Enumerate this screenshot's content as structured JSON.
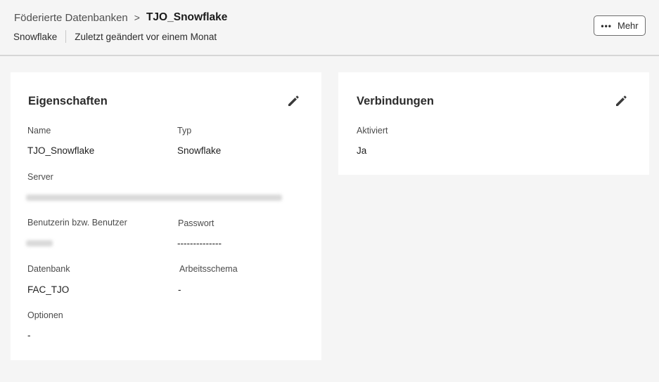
{
  "header": {
    "breadcrumb_parent": "Föderierte Datenbanken",
    "breadcrumb_separator": ">",
    "breadcrumb_current": "TJO_Snowflake",
    "db_type": "Snowflake",
    "last_modified": "Zuletzt geändert vor einem Monat",
    "more_button_label": "Mehr",
    "more_button_icon": "more-dots-icon"
  },
  "properties": {
    "title": "Eigenschaften",
    "edit_icon": "pencil-icon",
    "name_label": "Name",
    "name_value": "TJO_Snowflake",
    "type_label": "Typ",
    "type_value": "Snowflake",
    "server_label": "Server",
    "user_label": "Benutzerin bzw. Benutzer",
    "password_label": "Passwort",
    "password_value": "--------------",
    "database_label": "Datenbank",
    "database_value": "FAC_TJO",
    "schema_label": "Arbeitsschema",
    "schema_value": "-",
    "options_label": "Optionen",
    "options_value": "-"
  },
  "connections": {
    "title": "Verbindungen",
    "edit_icon": "pencil-icon",
    "activated_label": "Aktiviert",
    "activated_value": "Ja"
  }
}
